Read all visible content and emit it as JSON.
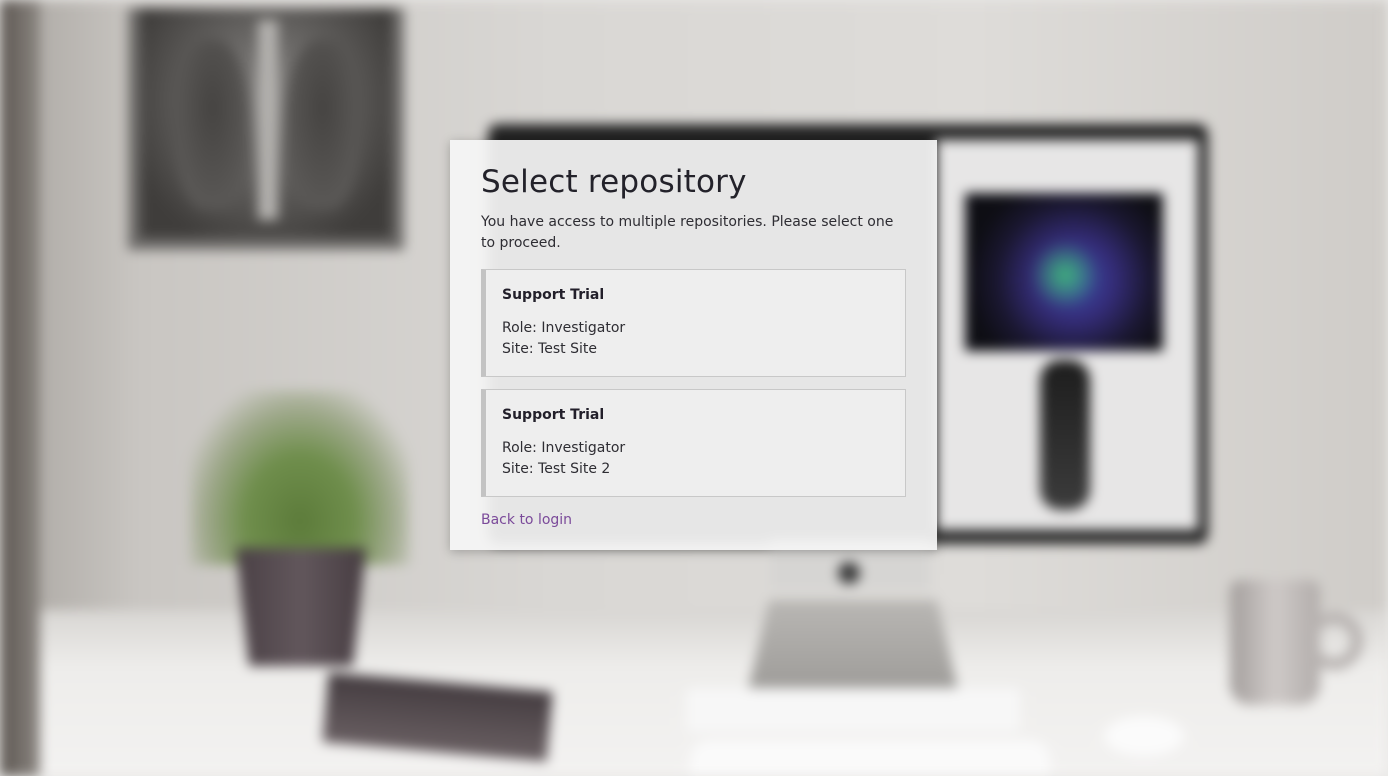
{
  "dialog": {
    "title": "Select repository",
    "description": "You have access to multiple repositories. Please select one to proceed.",
    "repositories": [
      {
        "name": "Support Trial",
        "role": "Role: Investigator",
        "site": "Site: Test Site"
      },
      {
        "name": "Support Trial",
        "role": "Role: Investigator",
        "site": "Site: Test Site 2"
      }
    ],
    "back_link": "Back to login"
  },
  "colors": {
    "link": "#7b4a9a",
    "card_background": "#f5f5f5",
    "item_accent_border": "#c3c3c3"
  }
}
